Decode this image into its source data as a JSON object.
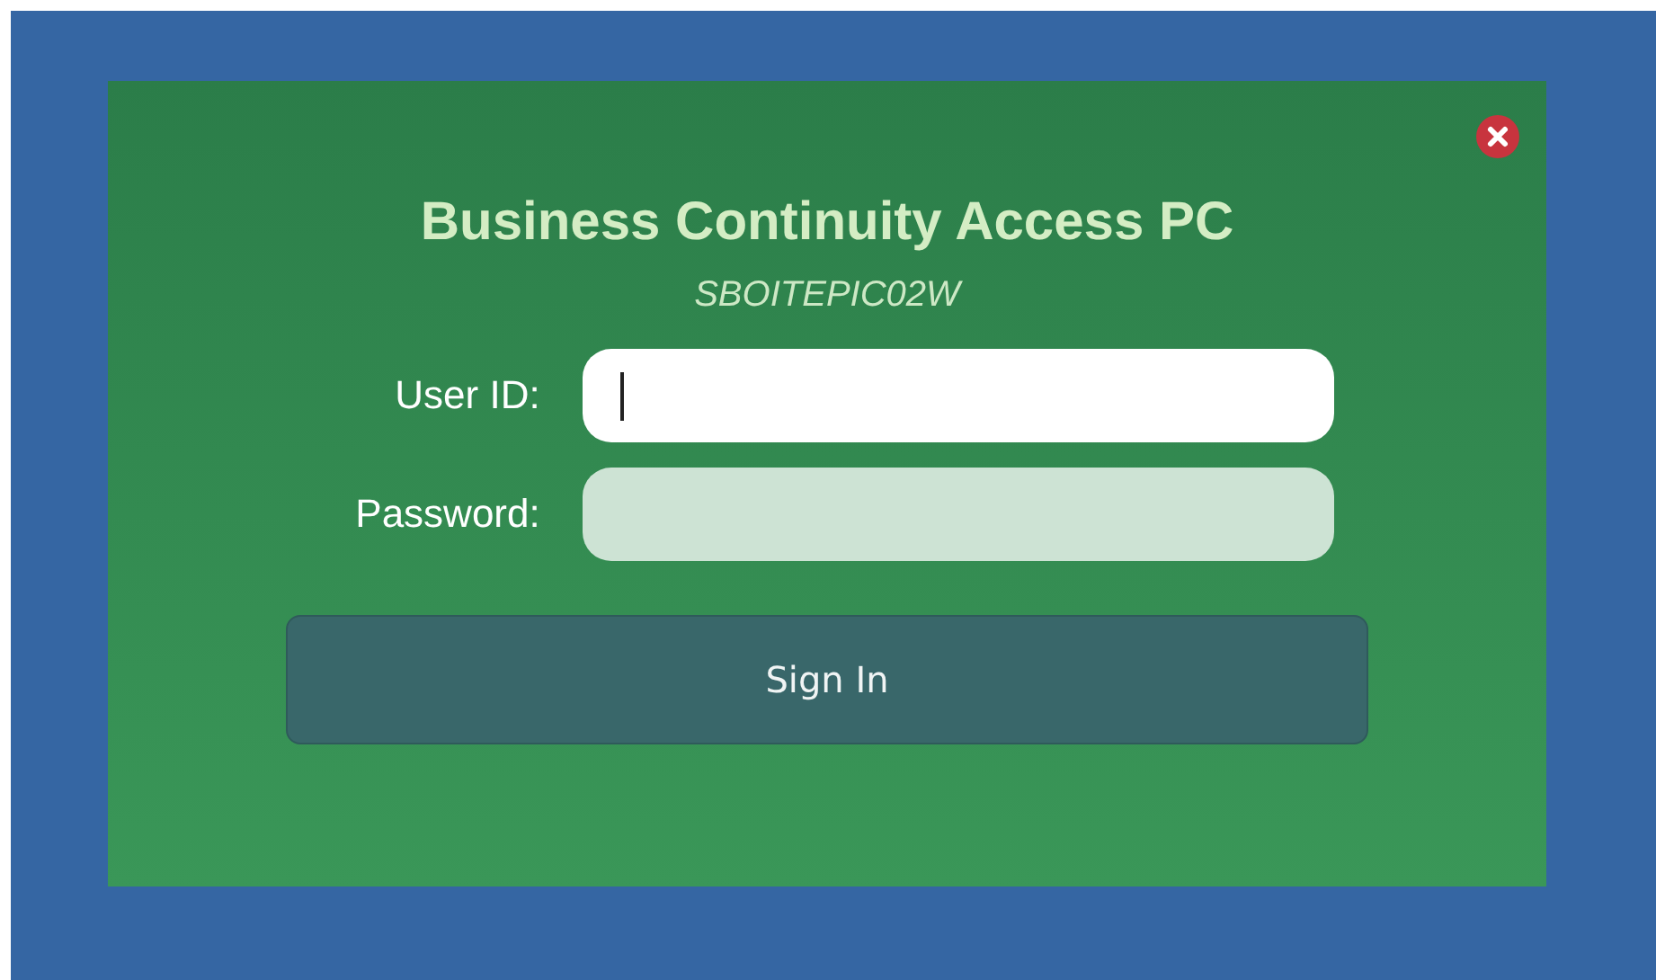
{
  "dialog": {
    "title": "Business Continuity Access PC",
    "subtitle": "SBOITEPIC02W"
  },
  "fields": [
    {
      "label": "User ID:",
      "focused": true
    },
    {
      "label": "Password:",
      "focused": false
    }
  ],
  "button": {
    "label": "Sign In"
  }
}
